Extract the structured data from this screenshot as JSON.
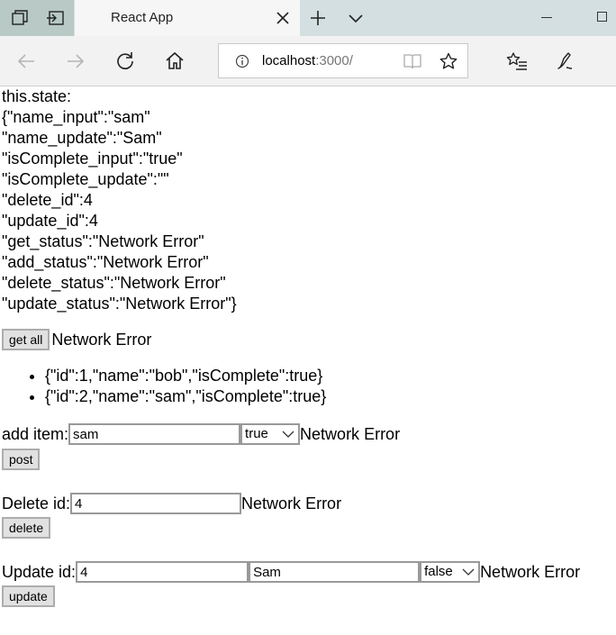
{
  "browser": {
    "tab_title": "React App",
    "address": {
      "host": "localhost",
      "port_path": ":3000/"
    }
  },
  "state_lines": [
    "this.state:",
    "{\"name_input\":\"sam\"",
    "\"name_update\":\"Sam\"",
    "\"isComplete_input\":\"true\"",
    "\"isComplete_update\":\"\"",
    "\"delete_id\":4",
    "\"update_id\":4",
    "\"get_status\":\"Network Error\"",
    "\"add_status\":\"Network Error\"",
    "\"delete_status\":\"Network Error\"",
    "\"update_status\":\"Network Error\"}"
  ],
  "get_all": {
    "button_label": "get all",
    "status": "Network Error"
  },
  "items": [
    "{\"id\":1,\"name\":\"bob\",\"isComplete\":true}",
    "{\"id\":2,\"name\":\"sam\",\"isComplete\":true}"
  ],
  "add_item": {
    "label": "add item:",
    "name_value": "sam",
    "select_value": "true",
    "status": "Network Error",
    "button_label": "post"
  },
  "delete": {
    "label": "Delete id:",
    "id_value": "4",
    "status": "Network Error",
    "button_label": "delete"
  },
  "update": {
    "label": "Update id:",
    "id_value": "4",
    "name_value": "Sam",
    "select_value": "false",
    "status": "Network Error",
    "button_label": "update"
  },
  "colors": {
    "tabbar": "#d4dfe1",
    "tab_active": "#f6f6f6",
    "navbar": "#f2f2f2",
    "button_face": "#e1e1e1"
  }
}
